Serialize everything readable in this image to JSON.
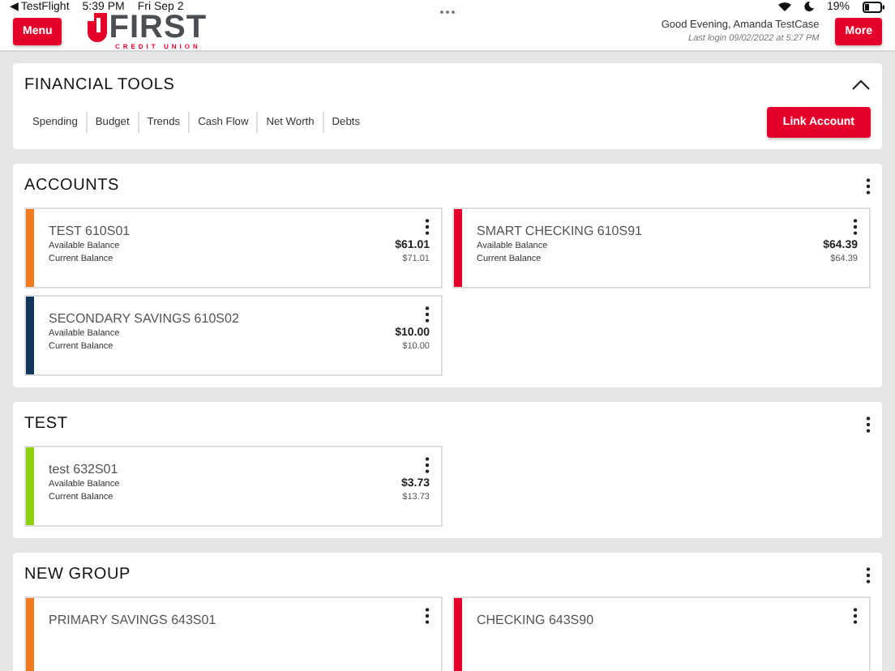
{
  "status_bar": {
    "back": "◀ TestFlight",
    "time": "5:39 PM",
    "date": "Fri Sep 2",
    "battery": "19%"
  },
  "header": {
    "menu_button": "Menu",
    "logo": {
      "wordmark": "FIRST",
      "tagline": "CREDIT UNION"
    },
    "greeting": "Good Evening, Amanda TestCase",
    "last_login": "Last login 09/02/2022 at 5:27 PM",
    "more_button": "More"
  },
  "financial_tools": {
    "title": "FINANCIAL TOOLS",
    "expanded": true,
    "tabs": [
      "Spending",
      "Budget",
      "Trends",
      "Cash Flow",
      "Net Worth",
      "Debts"
    ],
    "link_button": "Link Account"
  },
  "groups": [
    {
      "title": "ACCOUNTS",
      "accounts": [
        {
          "name": "TEST 610S01",
          "color": "#f07b1e",
          "available_label": "Available Balance",
          "available": "$61.01",
          "current_label": "Current Balance",
          "current": "$71.01"
        },
        {
          "name": "SMART CHECKING 610S91",
          "color": "#e4002b",
          "available_label": "Available Balance",
          "available": "$64.39",
          "current_label": "Current Balance",
          "current": "$64.39"
        },
        {
          "name": "SECONDARY SAVINGS 610S02",
          "color": "#12375a",
          "available_label": "Available Balance",
          "available": "$10.00",
          "current_label": "Current Balance",
          "current": "$10.00"
        }
      ]
    },
    {
      "title": "TEST",
      "accounts": [
        {
          "name": "test 632S01",
          "color": "#8cd211",
          "available_label": "Available Balance",
          "available": "$3.73",
          "current_label": "Current Balance",
          "current": "$13.73"
        }
      ]
    },
    {
      "title": "NEW GROUP",
      "accounts": [
        {
          "name": "PRIMARY SAVINGS 643S01",
          "color": "#f07b1e"
        },
        {
          "name": "CHECKING 643S90",
          "color": "#e4002b"
        }
      ]
    }
  ]
}
